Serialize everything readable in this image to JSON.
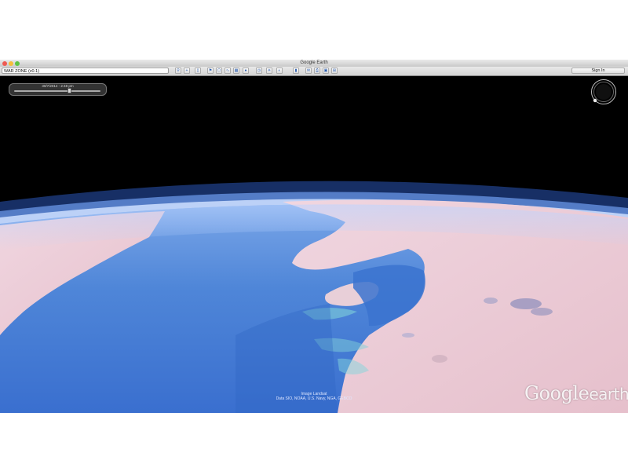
{
  "window": {
    "title": "Google Earth"
  },
  "toolbar": {
    "search_value": "WAR ZONE (v0.1)",
    "signin_label": "Sign In",
    "buttons": [
      {
        "icon": "search-icon",
        "glyph": "⚲"
      },
      {
        "icon": "plus-icon",
        "glyph": "+"
      },
      {
        "icon": "sidebar-icon",
        "glyph": "▯"
      },
      {
        "icon": "placemark-icon",
        "glyph": "⚑"
      },
      {
        "icon": "polygon-icon",
        "glyph": "⬠"
      },
      {
        "icon": "path-icon",
        "glyph": "∿"
      },
      {
        "icon": "overlay-icon",
        "glyph": "▦"
      },
      {
        "icon": "tour-icon",
        "glyph": "●"
      },
      {
        "icon": "historical-imagery-icon",
        "glyph": "◷"
      },
      {
        "icon": "sun-icon",
        "glyph": "☀"
      },
      {
        "icon": "planets-icon",
        "glyph": "◐"
      },
      {
        "icon": "ruler-icon",
        "glyph": "▮"
      },
      {
        "icon": "email-icon",
        "glyph": "✉"
      },
      {
        "icon": "print-icon",
        "glyph": "⎙"
      },
      {
        "icon": "save-image-icon",
        "glyph": "▣"
      },
      {
        "icon": "maps-icon",
        "glyph": "⊞"
      }
    ]
  },
  "time_slider": {
    "label": "30/7/2014 - 2:48 pm",
    "position_fraction": 0.64
  },
  "map": {
    "attribution_line1": "Image Landsat",
    "attribution_line2": "Data SIO, NOAA, U.S. Navy, NGA, GEBCO",
    "logo_google": "Google",
    "logo_earth": "earth"
  },
  "colors": {
    "space": "#000000",
    "sea": "#3f7ed0",
    "land": "#e9c6d2",
    "atmosphere": "#8fb8ff"
  }
}
